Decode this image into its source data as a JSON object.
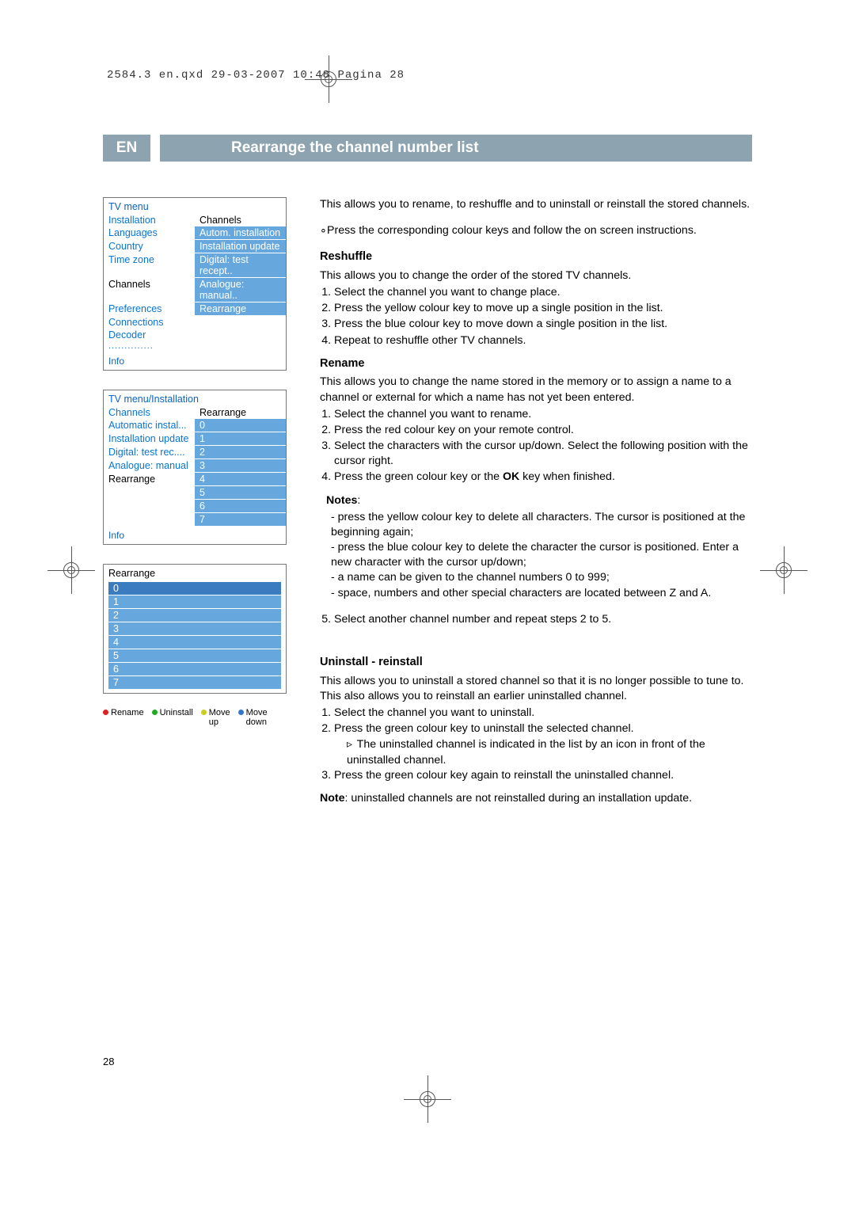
{
  "header": {
    "slug": "2584.3 en.qxd  29-03-2007  10:48  Pagina 28"
  },
  "title": {
    "lang": "EN",
    "text": "Rearrange the channel number list"
  },
  "menu1": {
    "title": "TV menu",
    "left": [
      "Installation",
      "Languages",
      "Country",
      "Time zone",
      "Channels",
      "Preferences",
      "Connections",
      "Decoder"
    ],
    "right": [
      "Channels",
      "Autom. installation",
      "Installation update",
      "Digital: test recept..",
      "Analogue: manual..",
      "Rearrange"
    ],
    "sel_left_index": 4,
    "info": "Info"
  },
  "menu2": {
    "title": "TV menu/Installation",
    "left": [
      "Channels",
      "Automatic instal...",
      "Installation update",
      "Digital: test rec....",
      "Analogue: manual",
      "Rearrange"
    ],
    "right": [
      "Rearrange",
      "0",
      "1",
      "2",
      "3",
      "4",
      "5",
      "6",
      "7"
    ],
    "sel_left_index": 5,
    "info": "Info"
  },
  "rearr": {
    "title": "Rearrange",
    "items": [
      "0",
      "1",
      "2",
      "3",
      "4",
      "5",
      "6",
      "7"
    ],
    "keys": [
      {
        "color": "red",
        "label": "Rename"
      },
      {
        "color": "green",
        "label": "Uninstall"
      },
      {
        "color": "yellow",
        "label": "Move\nup"
      },
      {
        "color": "blue",
        "label": "Move\ndown"
      }
    ]
  },
  "text": {
    "intro1": "This allows you to rename, to reshuffle and to uninstall or reinstall the stored channels.",
    "intro2": "Press the corresponding colour keys and follow the on screen instructions.",
    "reshuffle_h": "Reshuffle",
    "reshuffle_p": "This allows you to change the order of the stored TV channels.",
    "reshuffle_ol": [
      "Select the channel you want to change place.",
      "Press the yellow colour key  to move up a single position in the list.",
      "Press the blue colour key to move down a single position in the list.",
      "Repeat to reshuffle other TV channels."
    ],
    "rename_h": "Rename",
    "rename_p": "This allows you to change the name stored in the memory or to assign a name to a channel or external for which a name has not yet been entered.",
    "rename_ol1": [
      "Select the channel you want to rename.",
      "Press the red colour key on your remote control.",
      "Select the characters with the cursor up/down. Select the following position with the cursor right.",
      "Press the green colour key or the OK key when finished."
    ],
    "notes_lbl": "Notes",
    "notes_ul": [
      "press the yellow colour key to delete all characters. The cursor is positioned at the beginning again;",
      "press the blue colour key to delete the character the cursor is positioned. Enter a new character with the cursor up/down;",
      "a name can be given to the channel numbers 0 to 999;",
      "space, numbers and other special characters are located between Z and A."
    ],
    "rename_ol2": [
      "Select another channel number and repeat steps 2 to 5."
    ],
    "unin_h": "Uninstall - reinstall",
    "unin_p": "This allows you to uninstall a stored channel so that it is no longer possible to tune to. This also allows you to reinstall an earlier uninstalled channel.",
    "unin_ol": [
      "Select the channel you want to uninstall.",
      "Press the green colour key to uninstall the selected channel.",
      "Press the green colour key again to reinstall the uninstalled channel."
    ],
    "unin_sub": "The uninstalled channel is indicated in the list by an icon in front of the uninstalled channel.",
    "note2_pre": "Note",
    "note2_txt": ": uninstalled channels are not reinstalled during an installation update.",
    "ok": "OK"
  },
  "pagenum": "28"
}
